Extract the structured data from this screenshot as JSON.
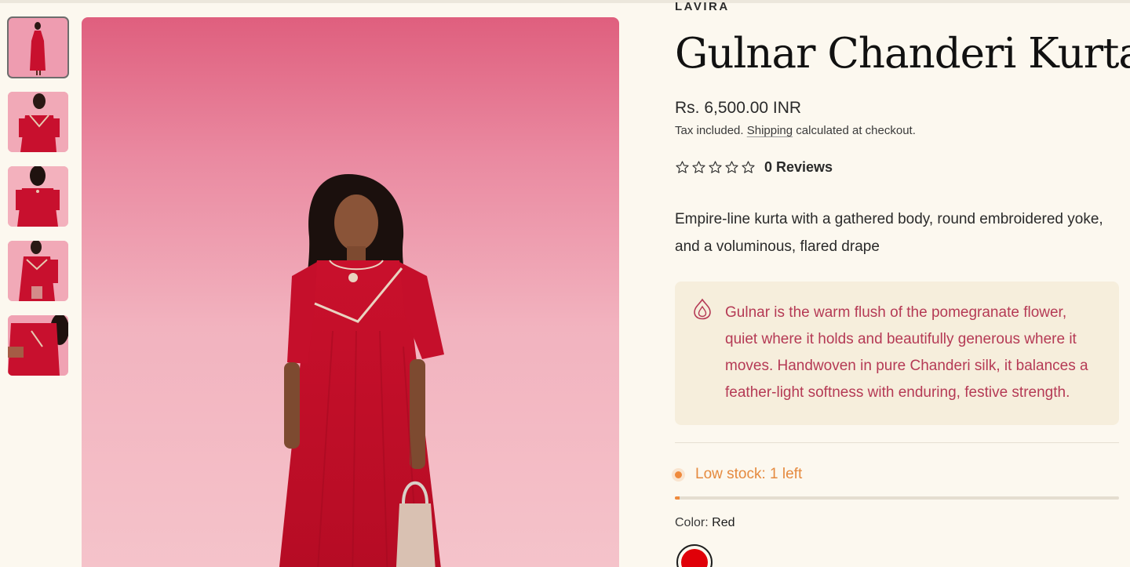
{
  "product": {
    "brand": "LAVIRA",
    "title": "Gulnar Chanderi Kurta",
    "price": "Rs. 6,500.00 INR",
    "tax_prefix": "Tax included.",
    "tax_link": "Shipping",
    "tax_suffix": "calculated at checkout.",
    "rating_stars": 0,
    "reviews": "0 Reviews",
    "description": "Empire-line kurta with a gathered body, round embroidered yoke, and a voluminous, flared drape",
    "story": "Gulnar is the warm flush of the pomegranate flower, quiet where it holds and beautifully generous where it moves. Handwoven in pure Chanderi silk, it balances a feather-light softness with enduring, festive strength.",
    "story_icon": "flame-drop-icon",
    "stock_text": "Low stock: 1 left",
    "stock_level": 0.01,
    "color_label": "Color:",
    "color_value": "Red",
    "swatch_color": "#e00008"
  },
  "gallery": {
    "thumbnail_count": 5,
    "active_index": 0
  },
  "colors": {
    "background": "#fcf8ef",
    "accent_pink": "#b53a55",
    "stock_orange": "#ef8a3c",
    "story_bg": "#f6eedc"
  }
}
